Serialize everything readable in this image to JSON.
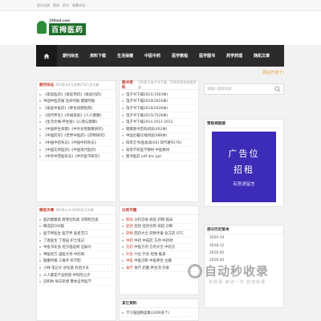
{
  "topbar": {
    "links": [
      "会员注册",
      "登录",
      "积分",
      "收藏本站"
    ]
  },
  "logo": {
    "url": "100md.com",
    "name": "百拇医药"
  },
  "nav": {
    "home_icon": "home-icon",
    "items": [
      "期刊杂志",
      "资料下载",
      "生活保健",
      "中医中药",
      "医学教程",
      "医学图书",
      "药学药理",
      "随机文章"
    ]
  },
  "notice": "网站开通了!",
  "journals": {
    "title": "期刊杂志",
    "sub": "650多本4万多期276万多文章",
    "rows": [
      "《家庭医药》《家庭用药》《家庭问药》",
      "中国中医药报 生命时报 健康时报",
      "《家庭中医药》《养生保健指南》",
      "《现代养生》《幸福家庭》《人人健康》",
      "《生活文摘·养生版》《心理与健康》",
      "《中国养生保健》《中外女性健康研究》",
      "《中国药房》《世界中医药》《药物研究》",
      "《中国中药杂志》《中国中药杂志》",
      "《中国实用医药》《中国现代医药》",
      "《中华中西医杂志》《中外医学研究》"
    ]
  },
  "ebooks": {
    "title": "图书资料",
    "sub": "100多万电子书下载，10000多份电视讲座",
    "rows": [
      "电子书下载2021(1583本)",
      "电子书下载2019(2616本)",
      "电子书下载2016(5028本)",
      "电子书下载2015(7528本)",
      "电子书下载2014 2013 2012",
      "健康图书百科阅读(402本)",
      "中国古籍在线阅读(688本)",
      "四库全书/医家类(60) 现代著作(76)",
      "高等学校医学教材 中医教材",
      "图书医药 pdf doc ppt"
    ]
  },
  "search": {
    "placeholder": "请输入搜索内容"
  },
  "ad": {
    "section_title": "赞助商链接",
    "line1": "广告位",
    "line2": "招租",
    "line3": "有意请留言"
  },
  "weekly": {
    "title": "微信文章",
    "sub": "800多公众号680多万文章",
    "rows": [
      "医药健康类 管理社科类 早期综合类",
      "精选前500篇",
      "医学界医生 医学界 医者苦口",
      "丁香医生 丁香园 护士笔记",
      "中医书友会 经方临证网 石斛号",
      "神医经方 国医大师 中药网",
      "健康时报 三维手 科学胆",
      "小林 笔记大 进化基 好后大夫",
      "人人都是产品经理 中科院之声",
      "迈和地 每日思想 整体自然医学"
    ]
  },
  "categories": {
    "title": "分类专题",
    "rows": [
      {
        "k": "疾病",
        "v": "分科全收 病症 药物 临床"
      },
      {
        "k": "症状",
        "v": "症状 症状名称 病因 诊断"
      },
      {
        "k": "药物",
        "v": "西药大全 药物手册 处方药 OTC"
      },
      {
        "k": "中药",
        "v": "中药 中成药 方剂 中药材"
      },
      {
        "k": "方药",
        "v": "中医方剂 方剂大全 中药方"
      },
      {
        "k": "针灸",
        "v": "穴位 针灸 经络 推拿"
      },
      {
        "k": "中医",
        "v": "中医诊断 中医养生 古籍"
      },
      {
        "k": "食疗",
        "v": "食疗 药膳 养生汤 饮食"
      }
    ]
  },
  "other": {
    "title": "其它资料",
    "rows": [
      "学习强国精品集(2400多个)"
    ]
  },
  "history": {
    "title": "部分历史版本",
    "rows": [
      "2020.10",
      "2018.12",
      "2016.05",
      "2016.04"
    ]
  },
  "watermark": {
    "brand": "自动秒收录",
    "tagline": "秒收录·来访一次·自动收录"
  },
  "colors": {
    "nav_bg": "#2b2b2b",
    "accent": "#c0392b",
    "ad_bg": "#3d2cb7",
    "logo_green": "#1f6f2b"
  }
}
